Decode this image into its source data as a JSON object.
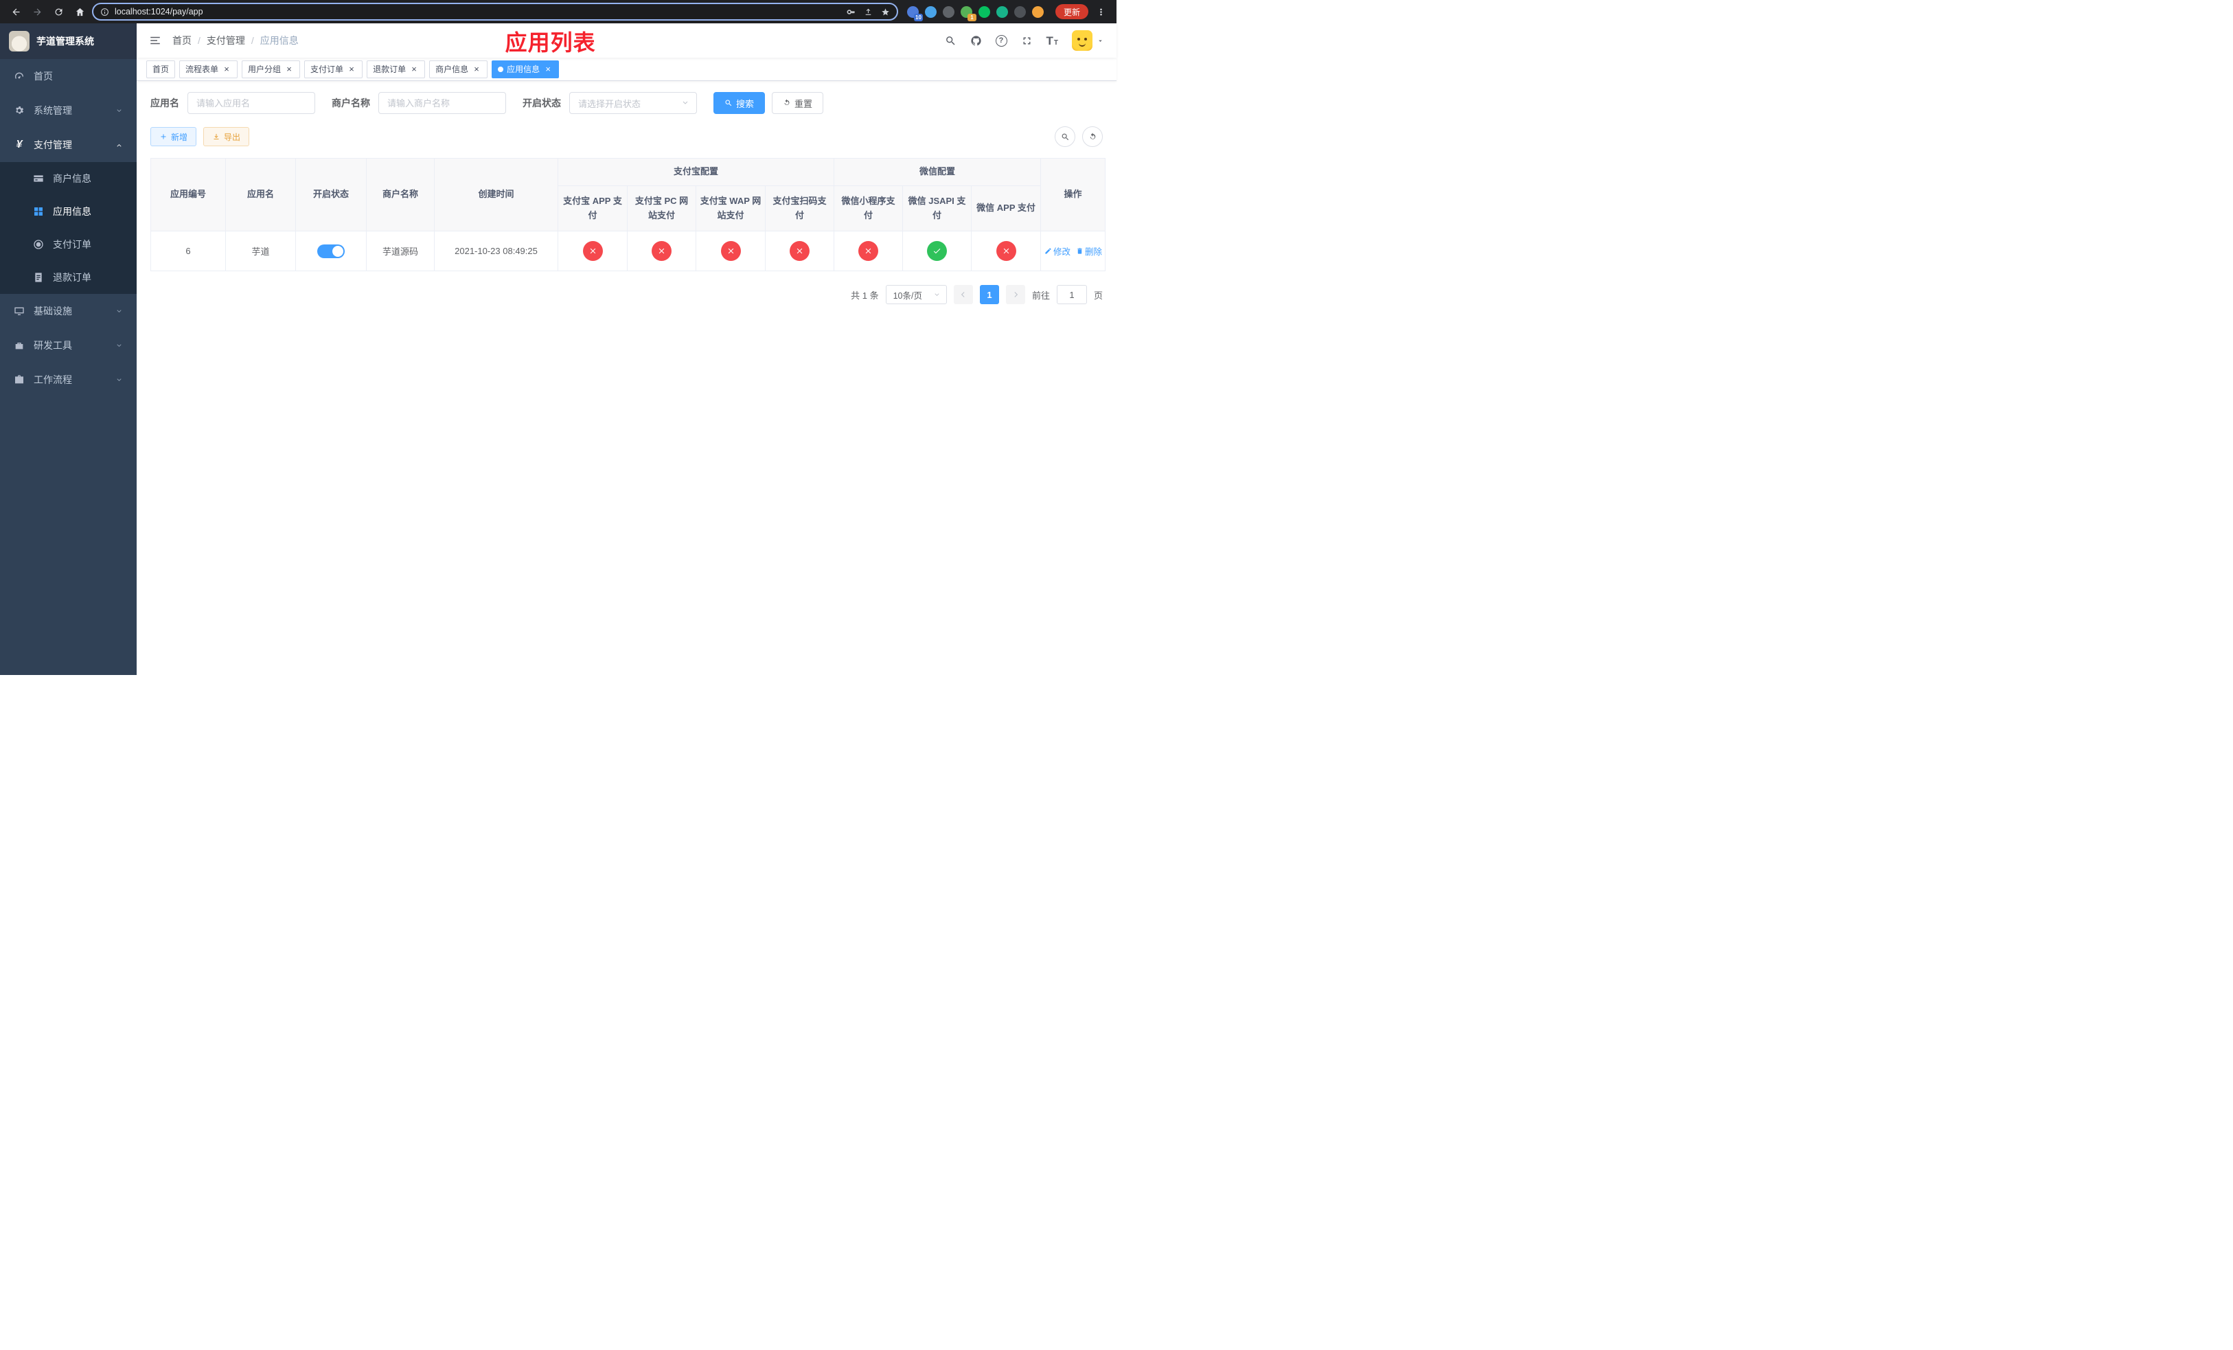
{
  "colors": {
    "accent": "#409eff",
    "danger": "#f5484d",
    "success": "#2fc25b",
    "warning": "#e6a23c",
    "annotation": "#f5222d",
    "sidebar_bg": "#304156",
    "submenu_bg": "#1f2d3d",
    "browser_bar_bg": "#202124"
  },
  "browser": {
    "url": "localhost:1024/pay/app",
    "update_label": "更新",
    "extensions": [
      {
        "name": "extension-puzzle",
        "color": "#4f7ddb",
        "badge": "10",
        "badge_color": "#3b6fd4"
      },
      {
        "name": "extension-drop",
        "color": "#49a3e8",
        "badge": ""
      },
      {
        "name": "extension-dark-globe",
        "color": "#5f6368",
        "badge": ""
      },
      {
        "name": "extension-leaf",
        "color": "#57b257",
        "badge": "1",
        "badge_color": "#e6a23c"
      },
      {
        "name": "extension-wechat",
        "color": "#07c160",
        "badge": ""
      },
      {
        "name": "extension-note",
        "color": "#18b48a",
        "badge": ""
      },
      {
        "name": "extension-pinwheel",
        "color": "#4e5257",
        "badge": ""
      },
      {
        "name": "extension-profile-face",
        "color": "#f2a33c",
        "badge": ""
      }
    ]
  },
  "sidebar": {
    "logo_title": "芋道管理系统",
    "menu": [
      {
        "key": "home",
        "label": "首页",
        "icon": "dashboard",
        "type": "leaf",
        "expanded": false
      },
      {
        "key": "system",
        "label": "系统管理",
        "icon": "gear",
        "type": "group",
        "expanded": false
      },
      {
        "key": "payment",
        "label": "支付管理",
        "icon": "yen",
        "type": "group",
        "expanded": true,
        "children": [
          {
            "key": "merchant-info",
            "label": "商户信息",
            "icon": "card",
            "active": false
          },
          {
            "key": "app-info",
            "label": "应用信息",
            "icon": "grid",
            "active": true
          },
          {
            "key": "pay-order",
            "label": "支付订单",
            "icon": "order",
            "active": false
          },
          {
            "key": "refund-order",
            "label": "退款订单",
            "icon": "refund",
            "active": false
          }
        ]
      },
      {
        "key": "infra",
        "label": "基础设施",
        "icon": "monitor",
        "type": "group",
        "expanded": false
      },
      {
        "key": "devtools",
        "label": "研发工具",
        "icon": "toolbox",
        "type": "group",
        "expanded": false
      },
      {
        "key": "workflow",
        "label": "工作流程",
        "icon": "briefcase",
        "type": "group",
        "expanded": false
      }
    ]
  },
  "header": {
    "breadcrumb": [
      "首页",
      "支付管理",
      "应用信息"
    ],
    "annotation": "应用列表"
  },
  "tabs": [
    {
      "key": "home",
      "label": "首页",
      "closable": false,
      "active": false
    },
    {
      "key": "process-form",
      "label": "流程表单",
      "closable": true,
      "active": false
    },
    {
      "key": "user-group",
      "label": "用户分组",
      "closable": true,
      "active": false
    },
    {
      "key": "pay-order",
      "label": "支付订单",
      "closable": true,
      "active": false
    },
    {
      "key": "refund-order",
      "label": "退款订单",
      "closable": true,
      "active": false
    },
    {
      "key": "merchant-info",
      "label": "商户信息",
      "closable": true,
      "active": false
    },
    {
      "key": "app-info",
      "label": "应用信息",
      "closable": true,
      "active": true
    }
  ],
  "filter": {
    "fields": [
      {
        "key": "app-name",
        "label": "应用名",
        "type": "input",
        "placeholder": "请输入应用名"
      },
      {
        "key": "merchant-name",
        "label": "商户名称",
        "type": "input",
        "placeholder": "请输入商户名称"
      },
      {
        "key": "enabled-status",
        "label": "开启状态",
        "type": "select",
        "placeholder": "请选择开启状态"
      }
    ],
    "search_label": "搜索",
    "reset_label": "重置"
  },
  "toolbar": {
    "add_label": "新增",
    "export_label": "导出"
  },
  "table": {
    "groups": [
      {
        "label": "支付宝配置",
        "span": 4
      },
      {
        "label": "微信配置",
        "span": 3
      }
    ],
    "columns_left": [
      "应用编号",
      "应用名",
      "开启状态",
      "商户名称",
      "创建时间"
    ],
    "columns_alipay": [
      "支付宝 APP 支付",
      "支付宝 PC 网站支付",
      "支付宝 WAP 网站支付",
      "支付宝扫码支付"
    ],
    "columns_wechat": [
      "微信小程序支付",
      "微信 JSAPI 支付",
      "微信 APP 支付"
    ],
    "column_actions": "操作",
    "rows": [
      {
        "id": "6",
        "name": "芋道",
        "enabled": true,
        "merchant": "芋道源码",
        "created": "2021-10-23 08:49:25",
        "statuses": [
          "x",
          "x",
          "x",
          "x",
          "x",
          "check",
          "x"
        ],
        "actions": [
          {
            "key": "edit",
            "label": "修改",
            "icon": "edit"
          },
          {
            "key": "delete",
            "label": "删除",
            "icon": "trash"
          }
        ]
      }
    ]
  },
  "pagination": {
    "total_text": "共 1 条",
    "page_size": "10条/页",
    "current_page": "1",
    "goto_prefix": "前往",
    "goto_value": "1",
    "goto_suffix": "页"
  }
}
